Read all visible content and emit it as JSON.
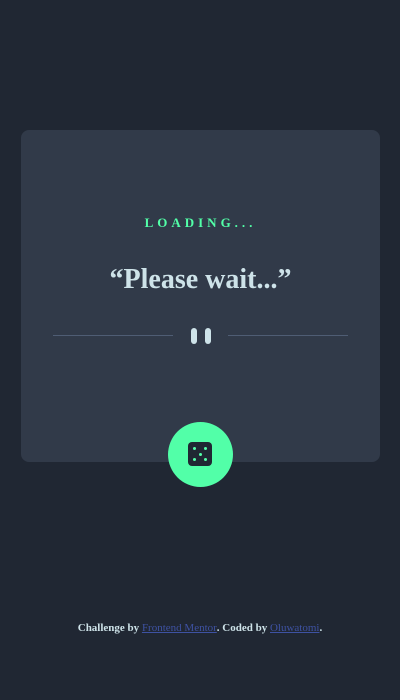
{
  "card": {
    "advice_label": "LOADING...",
    "quote": "“Please wait...”"
  },
  "icons": {
    "pause": "pause-icon",
    "dice": "dice-icon"
  },
  "footer": {
    "prefix": "Challenge by ",
    "link1": "Frontend Mentor",
    "middle": ". Coded by ",
    "link2": "Oluwatomi",
    "suffix": "."
  },
  "colors": {
    "background": "#202733",
    "card": "#313a49",
    "accent": "#52ffa8",
    "text": "#cee3e9",
    "divider": "#4f5d74",
    "link": "#3e52a3"
  }
}
